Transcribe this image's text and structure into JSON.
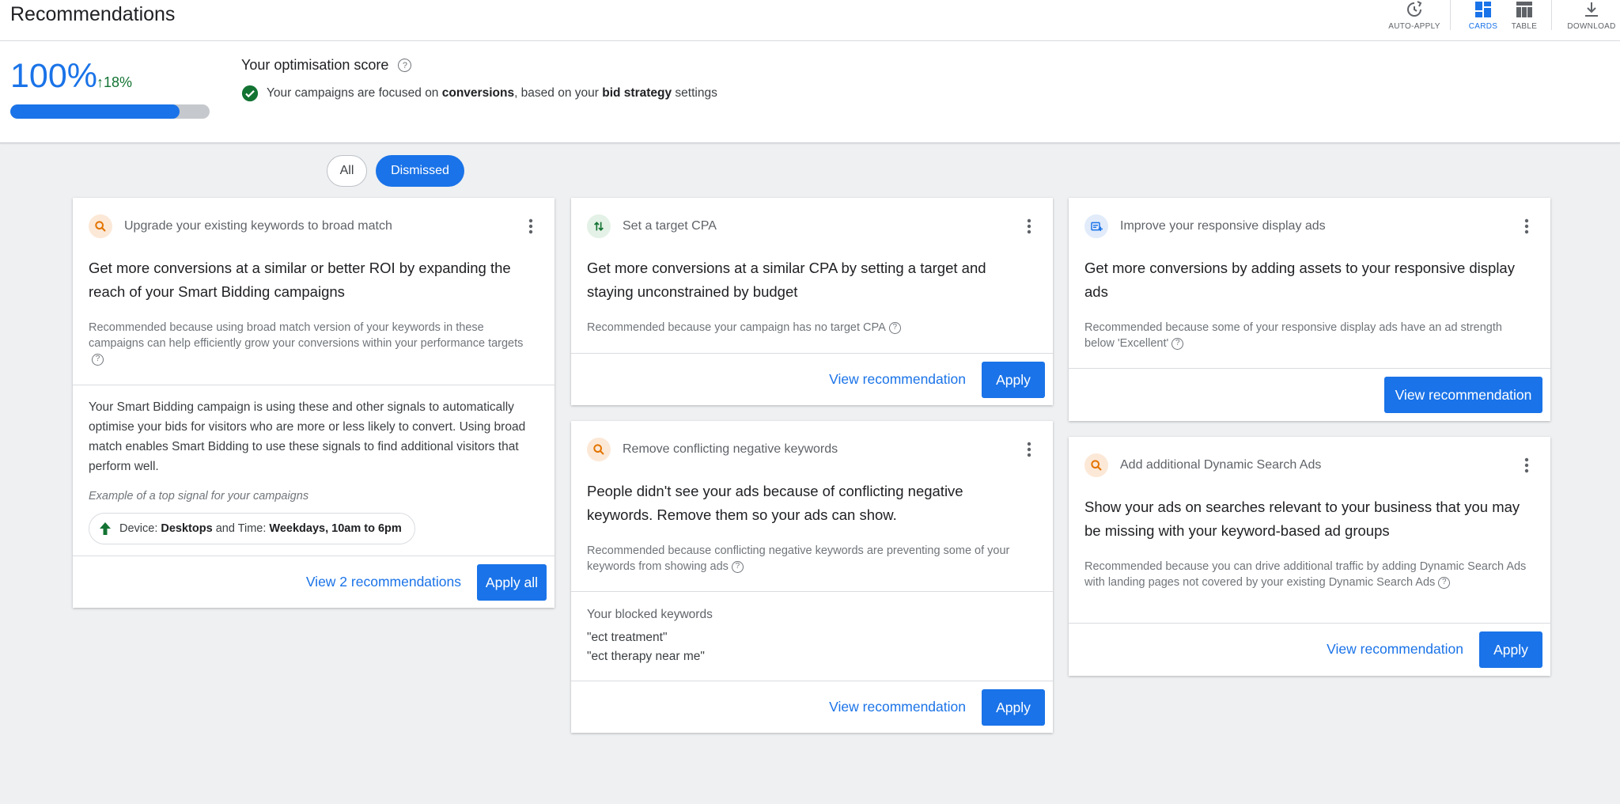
{
  "header": {
    "title": "Recommendations",
    "actions": {
      "auto_apply": "AUTO-APPLY",
      "cards": "CARDS",
      "table": "TABLE",
      "download": "DOWNLOAD"
    }
  },
  "score": {
    "value": "100%",
    "delta": "18%",
    "progress": 0.85,
    "title": "Your optimisation score",
    "line_pre": "Your campaigns are focused on",
    "line_conv": "conversions",
    "line_mid": ", based on your",
    "line_bid": "bid strategy",
    "line_post": "settings"
  },
  "filters": {
    "all": "All",
    "dismissed": "Dismissed"
  },
  "cards": {
    "broad": {
      "category": "Upgrade your existing keywords to broad match",
      "title": "Get more conversions at a similar or better ROI by expanding the reach of your Smart Bidding campaigns",
      "reason": "Recommended because using broad match version of your keywords in these campaigns can help efficiently grow your conversions within your performance targets",
      "body": "Your Smart Bidding campaign is using these and other signals to automatically optimise your bids for visitors who are more or less likely to convert. Using broad match enables Smart Bidding to use these signals to find additional visitors that perform well.",
      "example_label": "Example of a top signal for your campaigns",
      "signal_device_label": "Device:",
      "signal_device": "Desktops",
      "signal_and": "and Time:",
      "signal_time": "Weekdays, 10am to 6pm",
      "view_label": "View 2 recommendations",
      "apply_label": "Apply all"
    },
    "cpa": {
      "category": "Set a target CPA",
      "title": "Get more conversions at a similar CPA by setting a target and staying unconstrained by budget",
      "reason": "Recommended because your campaign has no target CPA",
      "view_label": "View recommendation",
      "apply_label": "Apply"
    },
    "negative": {
      "category": "Remove conflicting negative keywords",
      "title": "People didn't see your ads because of conflicting negative keywords. Remove them so your ads can show.",
      "reason": "Recommended because conflicting negative keywords are preventing some of your keywords from showing ads",
      "blocked_label": "Your blocked keywords",
      "keywords": [
        "\"ect treatment\"",
        "\"ect therapy near me\""
      ],
      "view_label": "View recommendation",
      "apply_label": "Apply"
    },
    "display": {
      "category": "Improve your responsive display ads",
      "title": "Get more conversions by adding assets to your responsive display ads",
      "reason": "Recommended because some of your responsive display ads have an ad strength below 'Excellent'",
      "view_label": "View recommendation"
    },
    "dsa": {
      "category": "Add additional Dynamic Search Ads",
      "title": "Show your ads on searches relevant to your business that you may be missing with your keyword-based ad groups",
      "reason": "Recommended because you can drive additional traffic by adding Dynamic Search Ads with landing pages not covered by your existing Dynamic Search Ads",
      "view_label": "View recommendation",
      "apply_label": "Apply"
    }
  },
  "colors": {
    "accent": "#1a73e8",
    "positive": "#137333",
    "icon_orange": "#e37400"
  }
}
